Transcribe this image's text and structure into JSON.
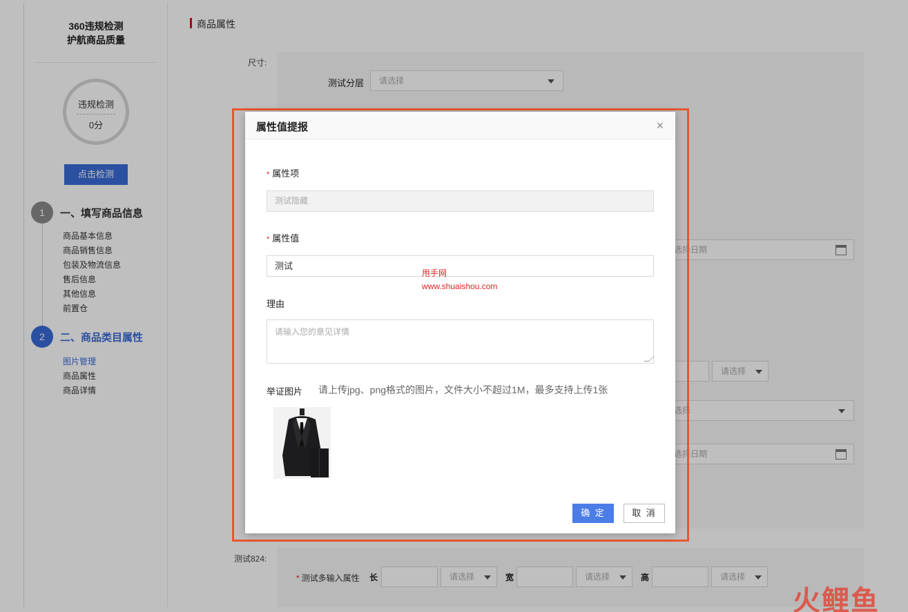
{
  "sidebar": {
    "brand_line1": "360违规检测",
    "brand_line2": "护航商品质量",
    "score": {
      "title": "违规检测",
      "value": "0分"
    },
    "check_button": "点击检测",
    "steps": [
      {
        "number": "1",
        "title": "一、填写商品信息",
        "items": [
          "商品基本信息",
          "商品销售信息",
          "包装及物流信息",
          "售后信息",
          "其他信息",
          "前置仓"
        ]
      },
      {
        "number": "2",
        "title": "二、商品类目属性",
        "items": [
          "图片管理",
          "商品属性",
          "商品详情"
        ]
      }
    ]
  },
  "main": {
    "section_title": "商品属性",
    "size_label": "尺寸:",
    "test_layer_label": "测试分层",
    "select_placeholder": "请选择",
    "date_placeholder": "选择日期",
    "select_partial": "选择",
    "test824_label": "测试824:",
    "multi_input_label": "测试多输入属性",
    "length_label": "长",
    "width_label": "宽",
    "height_label": "高"
  },
  "dialog": {
    "title": "属性值提报",
    "close_glyph": "×",
    "attr_item_label": "属性项",
    "attr_item_value": "测试隐藏",
    "attr_value_label": "属性值",
    "attr_value_value": "测试",
    "reason_label": "理由",
    "reason_placeholder": "请输入您的意见详情",
    "evidence_label": "举证图片",
    "evidence_hint": "请上传jpg、png格式的图片，文件大小不超过1M，最多支持上传1张",
    "ok_button": "确 定",
    "cancel_button": "取 消"
  },
  "watermark": {
    "line1": "甩手网",
    "line2": "www.shuaishou.com"
  },
  "corner_logo": "火鲤鱼",
  "colors": {
    "primary_blue": "#3a6bd8",
    "ok_blue": "#4a7de6",
    "highlight": "#e8572f",
    "section_red": "#c81623",
    "required_red": "#e02020"
  }
}
